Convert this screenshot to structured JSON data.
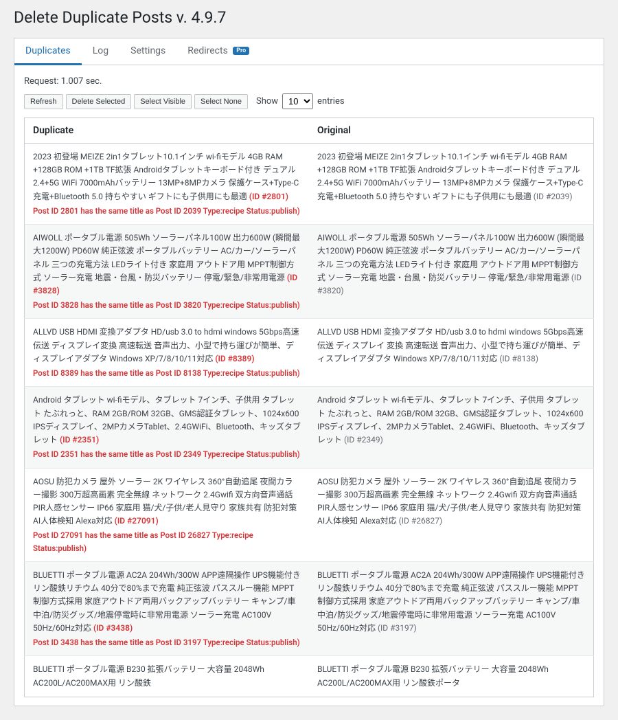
{
  "page_title": "Delete Duplicate Posts v. 4.9.7",
  "tabs": {
    "duplicates": "Duplicates",
    "log": "Log",
    "settings": "Settings",
    "redirects": "Redirects",
    "pro_badge": "Pro"
  },
  "request_text": "Request: 1.007 sec.",
  "toolbar": {
    "refresh": "Refresh",
    "delete_selected": "Delete Selected",
    "select_visible": "Select Visible",
    "select_none": "Select None",
    "show_label": "Show",
    "entries_label": "entries",
    "page_size": "10"
  },
  "columns": {
    "duplicate": "Duplicate",
    "original": "Original"
  },
  "rows": [
    {
      "dup_title": "2023 初登場 MEIZE 2in1タブレット10.1インチ wi-fiモデル 4GB RAM +128GB ROM +1TB TF拡張 Androidタブレットキーボード付き デュアル 2.4+5G WiFi 7000mAhバッテリー 13MP+8MPカメラ 保護ケース+Type-C充電+Bluetooth 5.0 持ちやすい ギフトにも子供用にも最適",
      "dup_id": "(ID #2801)",
      "status": "Post ID 2801 has the same title as Post ID 2039 Type:recipe Status:publish)",
      "orig_title": "2023 初登場 MEIZE 2in1タブレット10.1インチ wi-fiモデル 4GB RAM +128GB ROM +1TB TF拡張 Androidタブレットキーボード付き デュアル 2.4+5G WiFi 7000mAhバッテリー 13MP+8MPカメラ 保護ケース+Type-C充電+Bluetooth 5.0 持ちやすい ギフトにも子供用にも最適",
      "orig_id": "(ID #2039)"
    },
    {
      "dup_title": "AIWOLL ポータブル電源 505Wh ソーラーパネル100W 出力600W (瞬間最大1200W) PD60W 純正弦波 ポータブルバッテリー AC/カー/ソーラーパネル 三つの充電方法 LEDライト付き 家庭用 アウトドア用 MPPT制御方式 ソーラー充電 地震・台風・防災バッテリー 停電/緊急/非常用電源",
      "dup_id": "(ID #3828)",
      "status": "Post ID 3828 has the same title as Post ID 3820 Type:recipe Status:publish)",
      "orig_title": "AIWOLL ポータブル電源 505Wh ソーラーパネル100W 出力600W (瞬間最大1200W) PD60W 純正弦波 ポータブルバッテリー AC/カー/ソーラーパネル 三つの充電方法 LEDライト付き 家庭用 アウトドア用 MPPT制御方式 ソーラー充電 地震・台風・防災バッテリー 停電/緊急/非常用電源",
      "orig_id": "(ID #3820)"
    },
    {
      "dup_title": "ALLVD USB HDMI 変換アダプタ HD/usb 3.0 to hdmi windows 5Gbps高速伝送 ディスプレイ変換 高速転送 音声出力、小型で持ち運びが簡単、ディスプレイアダプタ Windows XP/7/8/10/11対応",
      "dup_id": "(ID #8389)",
      "status": "Post ID 8389 has the same title as Post ID 8138 Type:recipe Status:publish)",
      "orig_title": "ALLVD USB HDMI 変換アダプタ HD/usb 3.0 to hdmi windows 5Gbps高速伝送 ディスプレイ 変換 高速転送 音声出力、小型で持ち運びが簡単、ディスプレイアダプタ Windows XP/7/8/10/11対応",
      "orig_id": "(ID #8138)"
    },
    {
      "dup_title": "Android タブレット wi-fiモデル、タブレット 7インチ、子供用 タブレット たぶれっと、RAM 2GB/ROM 32GB、GMS認証タブレット、1024x600 IPSディスプレイ、2MPカメラTablet、2.4GWiFi、Bluetooth、キッズタブレット",
      "dup_id": "(ID #2351)",
      "status": "Post ID 2351 has the same title as Post ID 2349 Type:recipe Status:publish)",
      "orig_title": "Android タブレット wi-fiモデル、タブレット 7インチ、子供用 タブレット たぶれっと、RAM 2GB/ROM 32GB、GMS認証タブレット、1024x600 IPSディスプレイ、2MPカメラTablet、2.4GWiFi、Bluetooth、キッズタブレット",
      "orig_id": "(ID #2349)"
    },
    {
      "dup_title": "AOSU 防犯カメラ 屋外 ソーラー 2K ワイヤレス 360°自動追尾 夜間カラー撮影 300万超高画素 完全無線 ネットワーク 2.4Gwifi 双方向音声通話 PIR人感センサー IP66 家庭用 猫/犬/子供/老人見守り 家族共有 防犯対策 AI人体検知 Alexa対応",
      "dup_id": "(ID #27091)",
      "status": "Post ID 27091 has the same title as Post ID 26827 Type:recipe Status:publish)",
      "orig_title": "AOSU 防犯カメラ 屋外 ソーラー 2K ワイヤレス 360°自動追尾 夜間カラー撮影 300万超高画素 完全無線 ネットワーク 2.4Gwifi 双方向音声通話 PIR人感センサー IP66 家庭用 猫/犬/子供/老人見守り 家族共有 防犯対策 AI人体検知 Alexa対応",
      "orig_id": "(ID #26827)"
    },
    {
      "dup_title": "BLUETTI ポータブル電源 AC2A 204Wh/300W APP遠隔操作 UPS機能付き リン酸鉄リチウム 40分で80%まで充電 純正弦波 パススルー機能 MPPT制御方式採用 家庭アウトドア両用バックアップバッテリー キャンプ/車中泊/防災グッズ/地震停電時に非常用電源 ソーラー充電 AC100V 50Hz/60Hz対応",
      "dup_id": "(ID #3438)",
      "status": "Post ID 3438 has the same title as Post ID 3197 Type:recipe Status:publish)",
      "orig_title": "BLUETTI ポータブル電源 AC2A 204Wh/300W APP遠隔操作 UPS機能付き リン酸鉄リチウム 40分で80%まで充電 純正弦波 パススルー機能 MPPT制御方式採用 家庭アウトドア両用バックアップバッテリー キャンプ/車中泊/防災グッズ/地震停電時に非常用電源 ソーラー充電 AC100V 50Hz/60Hz対応",
      "orig_id": "(ID #3197)"
    },
    {
      "dup_title": "BLUETTI ポータブル電源 B230 拡張バッテリー 大容量 2048Wh AC200L/AC200MAX用 リン酸鉄",
      "dup_id": "",
      "status": "",
      "orig_title": "BLUETTI ポータブル電源 B230 拡張バッテリー 大容量 2048Wh AC200L/AC200MAX用 リン酸鉄ポータ",
      "orig_id": ""
    }
  ]
}
